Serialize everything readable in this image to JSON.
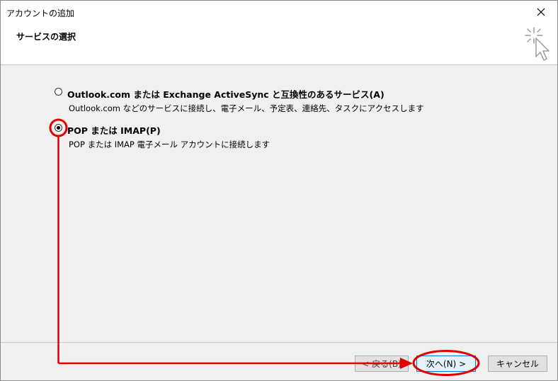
{
  "window": {
    "title": "アカウントの追加",
    "close_symbol": "✕"
  },
  "header": {
    "title": "サービスの選択",
    "icon": "wizard-cursor-sparkle-icon"
  },
  "options": [
    {
      "label": "Outlook.com または Exchange ActiveSync と互換性のあるサービス(A)",
      "description": "Outlook.com などのサービスに接続し、電子メール、予定表、連絡先、タスクにアクセスします",
      "selected": false
    },
    {
      "label": "POP または IMAP(P)",
      "description": "POP または IMAP 電子メール アカウントに接続します",
      "selected": true
    }
  ],
  "buttons": {
    "back": "< 戻る(B)",
    "next": "次へ(N) >",
    "cancel": "キャンセル"
  },
  "annotation": {
    "color": "#e00000",
    "type": "red circles with connecting arrow from selected radio to next button"
  }
}
